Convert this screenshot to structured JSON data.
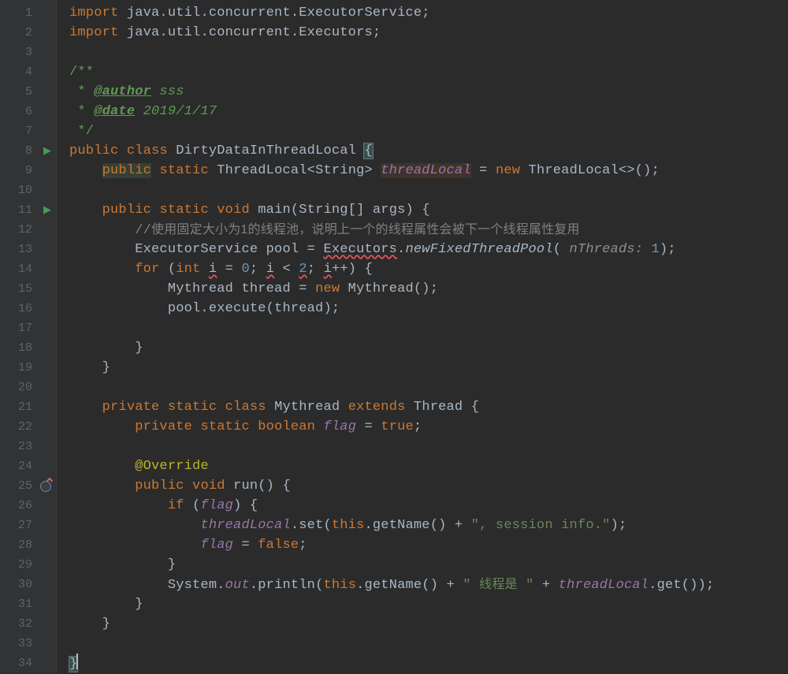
{
  "lines": {
    "1": "1",
    "2": "2",
    "3": "3",
    "4": "4",
    "5": "5",
    "6": "6",
    "7": "7",
    "8": "8",
    "9": "9",
    "10": "10",
    "11": "11",
    "12": "12",
    "13": "13",
    "14": "14",
    "15": "15",
    "16": "16",
    "17": "17",
    "18": "18",
    "19": "19",
    "20": "20",
    "21": "21",
    "22": "22",
    "23": "23",
    "24": "24",
    "25": "25",
    "26": "26",
    "27": "27",
    "28": "28",
    "29": "29",
    "30": "30",
    "31": "31",
    "32": "32",
    "33": "33",
    "34": "34"
  },
  "code": {
    "import": "import",
    "pkg1": " java.util.concurrent.ExecutorService;",
    "pkg2": " java.util.concurrent.Executors;",
    "docStart": "/**",
    "docStar": " * ",
    "authorTag": "@author",
    "authorVal": " sss",
    "dateTag": "@date",
    "dateVal": " 2019/1/17",
    "docEnd": " */",
    "public": "public",
    "class": "class",
    "className": " DirtyDataInThreadLocal ",
    "lbrace": "{",
    "rbrace": "}",
    "static": "static",
    "threadLocalType": " ThreadLocal<String> ",
    "threadLocalName": "threadLocal",
    "eq": " = ",
    "new": "new",
    "threadLocalNew": " ThreadLocal<>();",
    "void": "void",
    "main": " main",
    "mainArgs": "(String[] args) {",
    "comment12a": "//",
    "comment12b": "使用固定大小为1的线程池，说明上一个的线程属性会被下一个线程属性复用",
    "esType": "ExecutorService pool = ",
    "executors": "Executors",
    "dot": ".",
    "newFixed": "newFixedThreadPool",
    "paren": "(",
    "nThreads": " nThreads: ",
    "one": "1",
    "rparenSemi": ");",
    "for": "for",
    "forParen": " (",
    "int": "int",
    "iVar": "i",
    "zero": "0",
    "semiSp": "; ",
    "lt": " < ",
    "two": "2",
    "inc": "++",
    "rparenBrace": ") {",
    "mythreadDecl": "Mythread thread = ",
    "mythreadNew": " Mythread();",
    "poolExec": "pool.execute(thread);",
    "private": "private",
    "mythreadClass": " Mythread ",
    "extends": "extends",
    "threadClass": " Thread {",
    "boolean": "boolean",
    "flagName": "flag",
    "true": "true",
    "false": "false",
    "semi": ";",
    "override": "@Override",
    "run": " run",
    "runParen": "() {",
    "if": "if",
    "ifParen": " (",
    "l27a": ".set(",
    "this": "this",
    "l27b": ".getName() + ",
    "l27str": "\", session info.\"",
    "l27c": ");",
    "sout": "System.",
    "out": "out",
    "println": ".println(",
    "l30b": ".getName() + ",
    "l30str1": "\" ",
    "l30cjk": "线程是",
    "l30str2": " \"",
    "plus": " + ",
    "l30get": ".get());"
  }
}
